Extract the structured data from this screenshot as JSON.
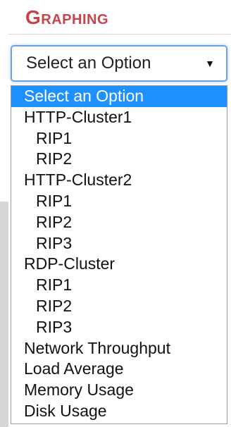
{
  "section": {
    "title": "Graphing"
  },
  "select": {
    "value": "Select an Option",
    "arrow_icon": "dropdown-arrow-icon"
  },
  "dropdown": {
    "highlight_color": "#1e90ff",
    "options": [
      {
        "label": "Select an Option",
        "level": 0,
        "selected": true
      },
      {
        "label": "HTTP-Cluster1",
        "level": 0,
        "selected": false
      },
      {
        "label": "RIP1",
        "level": 1,
        "selected": false
      },
      {
        "label": "RIP2",
        "level": 1,
        "selected": false
      },
      {
        "label": "HTTP-Cluster2",
        "level": 0,
        "selected": false
      },
      {
        "label": "RIP1",
        "level": 1,
        "selected": false
      },
      {
        "label": "RIP2",
        "level": 1,
        "selected": false
      },
      {
        "label": "RIP3",
        "level": 1,
        "selected": false
      },
      {
        "label": "RDP-Cluster",
        "level": 0,
        "selected": false
      },
      {
        "label": "RIP1",
        "level": 1,
        "selected": false
      },
      {
        "label": "RIP2",
        "level": 1,
        "selected": false
      },
      {
        "label": "RIP3",
        "level": 1,
        "selected": false
      },
      {
        "label": "Network Throughput",
        "level": 0,
        "selected": false
      },
      {
        "label": "Load Average",
        "level": 0,
        "selected": false
      },
      {
        "label": "Memory Usage",
        "level": 0,
        "selected": false
      },
      {
        "label": "Disk Usage",
        "level": 0,
        "selected": false
      }
    ]
  }
}
